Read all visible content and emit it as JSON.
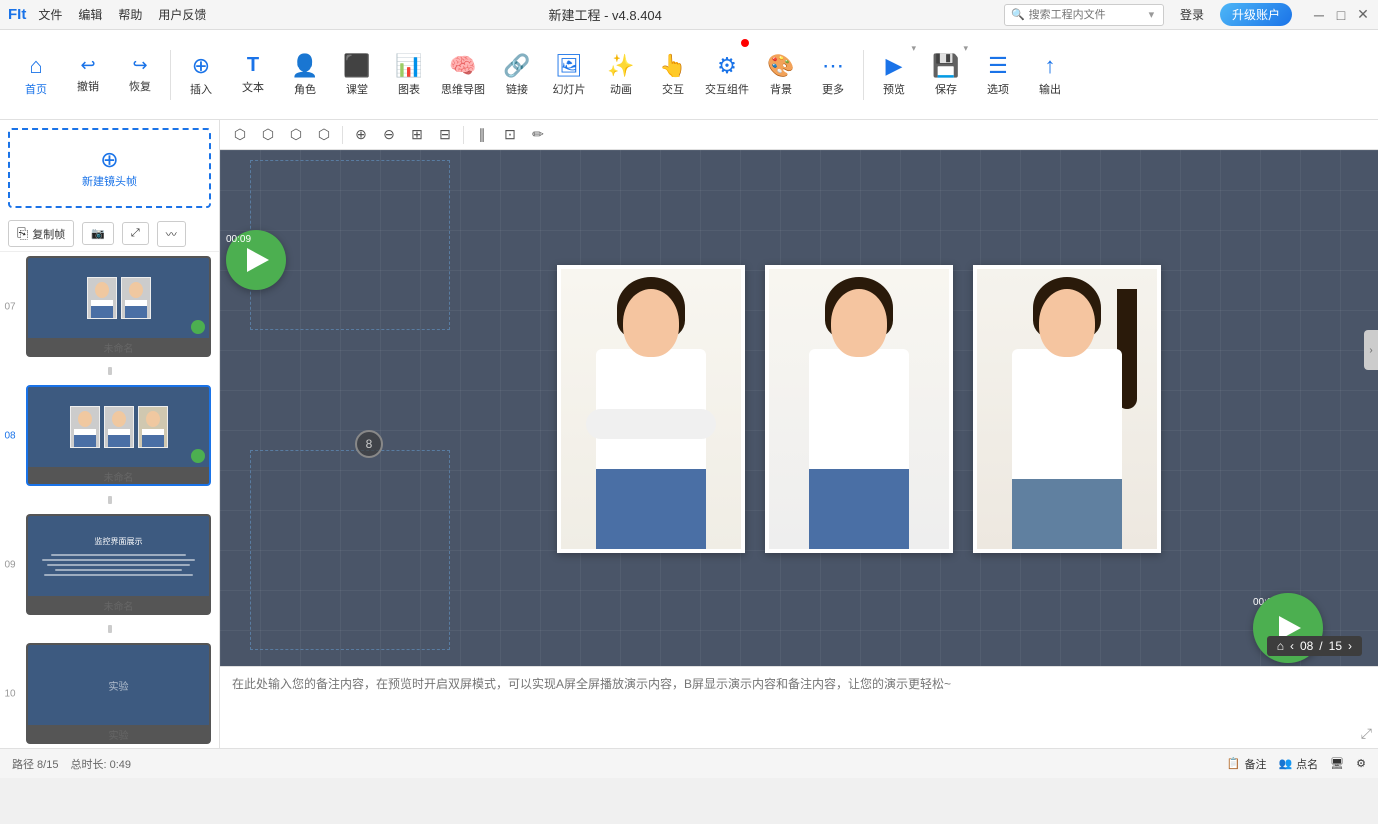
{
  "titlebar": {
    "logo": "FIt",
    "menu": [
      "文件",
      "编辑",
      "帮助",
      "用户反馈"
    ],
    "title": "新建工程 - v4.8.404",
    "search_placeholder": "搜索工程内文件",
    "login_label": "登录",
    "upgrade_label": "升级账户",
    "win_min": "─",
    "win_max": "□",
    "win_close": "✕"
  },
  "toolbar": {
    "items": [
      {
        "id": "home",
        "icon": "⌂",
        "label": "首页"
      },
      {
        "id": "undo",
        "icon": "↩",
        "label": "撤销"
      },
      {
        "id": "redo",
        "icon": "↪",
        "label": "恢复"
      },
      {
        "id": "insert",
        "icon": "⊕",
        "label": "插入"
      },
      {
        "id": "text",
        "icon": "T",
        "label": "文本"
      },
      {
        "id": "role",
        "icon": "👤",
        "label": "角色"
      },
      {
        "id": "class",
        "icon": "⬛",
        "label": "课堂"
      },
      {
        "id": "chart",
        "icon": "📊",
        "label": "图表"
      },
      {
        "id": "mindmap",
        "icon": "🧠",
        "label": "思维导图"
      },
      {
        "id": "link",
        "icon": "🔗",
        "label": "链接"
      },
      {
        "id": "slide",
        "icon": "🖼",
        "label": "幻灯片"
      },
      {
        "id": "animate",
        "icon": "✨",
        "label": "动画"
      },
      {
        "id": "interact",
        "icon": "👆",
        "label": "交互"
      },
      {
        "id": "component",
        "icon": "⚙",
        "label": "交互组件"
      },
      {
        "id": "bg",
        "icon": "🎨",
        "label": "背景"
      },
      {
        "id": "more",
        "icon": "⋯",
        "label": "更多"
      },
      {
        "id": "preview",
        "icon": "▶",
        "label": "预览"
      },
      {
        "id": "save",
        "icon": "💾",
        "label": "保存"
      },
      {
        "id": "options",
        "icon": "☰",
        "label": "选项"
      },
      {
        "id": "export",
        "icon": "↑",
        "label": "输出"
      }
    ]
  },
  "canvas_toolbar": {
    "tools": [
      "⬡",
      "⬡",
      "⬡",
      "⬡",
      "⬡",
      "⊕",
      "⊖",
      "⊞",
      "⊟",
      "⊞",
      "∥",
      "⊡",
      "✏"
    ]
  },
  "slides": [
    {
      "number": "07",
      "name": "未命名",
      "active": false
    },
    {
      "number": "08",
      "name": "未命名",
      "active": true
    },
    {
      "number": "09",
      "name": "未命名",
      "active": false
    },
    {
      "number": "10",
      "name": "实验",
      "active": false
    }
  ],
  "new_frame": {
    "label": "新建镜头帧"
  },
  "copy_frame_label": "复制帧",
  "slide_badge": "8",
  "play_times": {
    "top": "00:09",
    "bottom": "00:28"
  },
  "page_nav": {
    "current": "08",
    "total": "15"
  },
  "notes_placeholder": "在此处输入您的备注内容，在预览时开启双屏模式，可以实现A屏全屏播放演示内容，B屏显示演示内容和备注内容，让您的演示更轻松~",
  "bottombar": {
    "path": "路径 8/15",
    "duration": "总时长: 0:49",
    "actions": [
      "备注",
      "点名"
    ]
  }
}
